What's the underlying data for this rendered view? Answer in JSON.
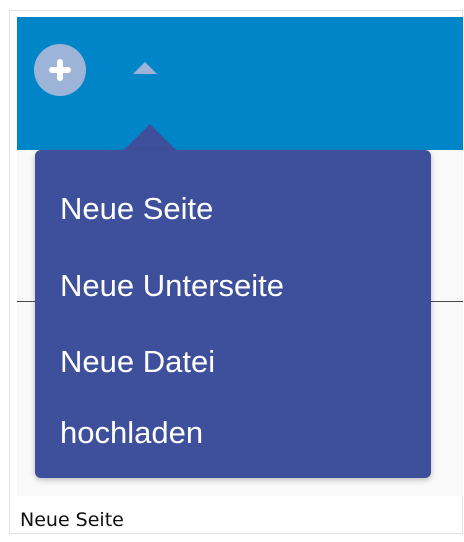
{
  "toolbar": {
    "add_icon": "plus-icon",
    "dropdown_icon": "caret-up-icon",
    "colors": {
      "bar": "#0086c8",
      "button": "#9db3d8",
      "menu": "#3e4f9b"
    }
  },
  "menu": {
    "items": [
      {
        "label": "Neue Seite"
      },
      {
        "label": "Neue Unterseite"
      },
      {
        "label_line1": "Neue Datei",
        "label_line2": "hochladen"
      }
    ]
  },
  "caption": "Neue Seite"
}
